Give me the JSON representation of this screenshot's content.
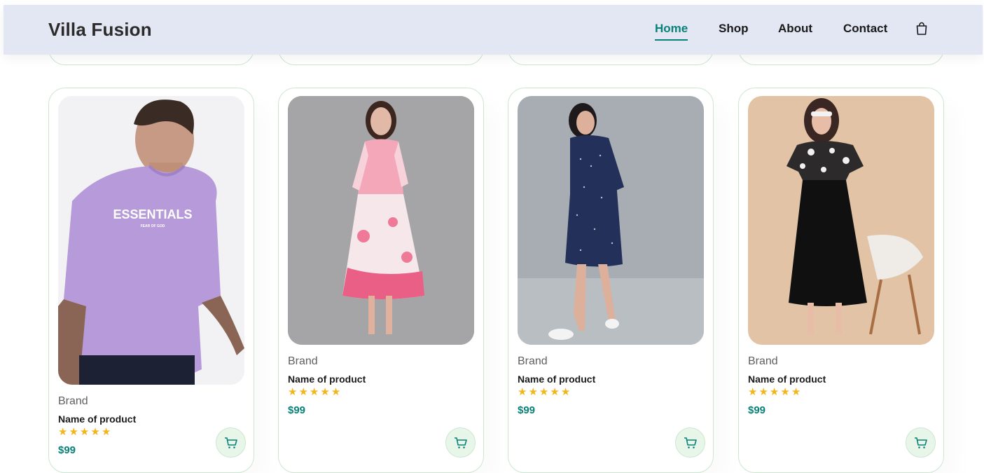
{
  "header": {
    "logo": "Villa Fusion",
    "nav": [
      {
        "label": "Home",
        "active": true
      },
      {
        "label": "Shop",
        "active": false
      },
      {
        "label": "About",
        "active": false
      },
      {
        "label": "Contact",
        "active": false
      }
    ],
    "bag_icon": "shopping-bag-icon"
  },
  "colors": {
    "accent": "#088178",
    "star": "#f3b519",
    "nav_bg": "#e3e6f3",
    "card_border": "#cce7d0",
    "cart_bg": "#e8f6ea"
  },
  "products": [
    {
      "image_text": "ESSENTIALS",
      "image_subtext": "FEAR OF GOD",
      "brand": "Brand",
      "name": "Name of product",
      "rating": 5,
      "price": "$99",
      "cart_icon": "cart-icon"
    },
    {
      "brand": "Brand",
      "name": "Name of product",
      "rating": 5,
      "price": "$99",
      "cart_icon": "cart-icon"
    },
    {
      "brand": "Brand",
      "name": "Name of product",
      "rating": 5,
      "price": "$99",
      "cart_icon": "cart-icon"
    },
    {
      "brand": "Brand",
      "name": "Name of product",
      "rating": 5,
      "price": "$99",
      "cart_icon": "cart-icon"
    }
  ]
}
